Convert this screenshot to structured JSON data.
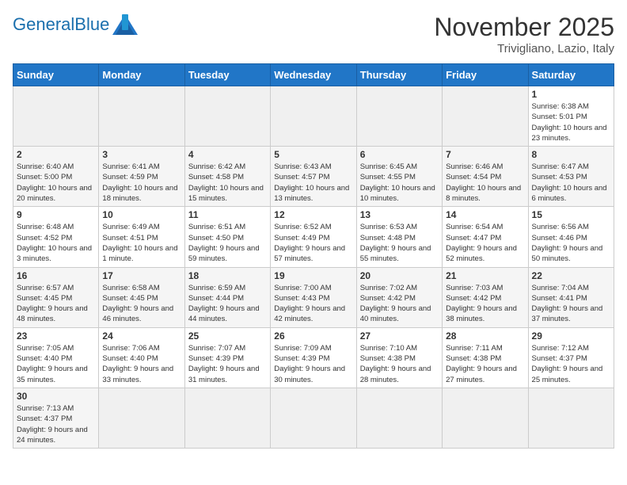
{
  "header": {
    "logo_general": "General",
    "logo_blue": "Blue",
    "month_title": "November 2025",
    "subtitle": "Trivigliano, Lazio, Italy"
  },
  "days_of_week": [
    "Sunday",
    "Monday",
    "Tuesday",
    "Wednesday",
    "Thursday",
    "Friday",
    "Saturday"
  ],
  "weeks": [
    [
      {
        "day": "",
        "info": ""
      },
      {
        "day": "",
        "info": ""
      },
      {
        "day": "",
        "info": ""
      },
      {
        "day": "",
        "info": ""
      },
      {
        "day": "",
        "info": ""
      },
      {
        "day": "",
        "info": ""
      },
      {
        "day": "1",
        "info": "Sunrise: 6:38 AM\nSunset: 5:01 PM\nDaylight: 10 hours and 23 minutes."
      }
    ],
    [
      {
        "day": "2",
        "info": "Sunrise: 6:40 AM\nSunset: 5:00 PM\nDaylight: 10 hours and 20 minutes."
      },
      {
        "day": "3",
        "info": "Sunrise: 6:41 AM\nSunset: 4:59 PM\nDaylight: 10 hours and 18 minutes."
      },
      {
        "day": "4",
        "info": "Sunrise: 6:42 AM\nSunset: 4:58 PM\nDaylight: 10 hours and 15 minutes."
      },
      {
        "day": "5",
        "info": "Sunrise: 6:43 AM\nSunset: 4:57 PM\nDaylight: 10 hours and 13 minutes."
      },
      {
        "day": "6",
        "info": "Sunrise: 6:45 AM\nSunset: 4:55 PM\nDaylight: 10 hours and 10 minutes."
      },
      {
        "day": "7",
        "info": "Sunrise: 6:46 AM\nSunset: 4:54 PM\nDaylight: 10 hours and 8 minutes."
      },
      {
        "day": "8",
        "info": "Sunrise: 6:47 AM\nSunset: 4:53 PM\nDaylight: 10 hours and 6 minutes."
      }
    ],
    [
      {
        "day": "9",
        "info": "Sunrise: 6:48 AM\nSunset: 4:52 PM\nDaylight: 10 hours and 3 minutes."
      },
      {
        "day": "10",
        "info": "Sunrise: 6:49 AM\nSunset: 4:51 PM\nDaylight: 10 hours and 1 minute."
      },
      {
        "day": "11",
        "info": "Sunrise: 6:51 AM\nSunset: 4:50 PM\nDaylight: 9 hours and 59 minutes."
      },
      {
        "day": "12",
        "info": "Sunrise: 6:52 AM\nSunset: 4:49 PM\nDaylight: 9 hours and 57 minutes."
      },
      {
        "day": "13",
        "info": "Sunrise: 6:53 AM\nSunset: 4:48 PM\nDaylight: 9 hours and 55 minutes."
      },
      {
        "day": "14",
        "info": "Sunrise: 6:54 AM\nSunset: 4:47 PM\nDaylight: 9 hours and 52 minutes."
      },
      {
        "day": "15",
        "info": "Sunrise: 6:56 AM\nSunset: 4:46 PM\nDaylight: 9 hours and 50 minutes."
      }
    ],
    [
      {
        "day": "16",
        "info": "Sunrise: 6:57 AM\nSunset: 4:45 PM\nDaylight: 9 hours and 48 minutes."
      },
      {
        "day": "17",
        "info": "Sunrise: 6:58 AM\nSunset: 4:45 PM\nDaylight: 9 hours and 46 minutes."
      },
      {
        "day": "18",
        "info": "Sunrise: 6:59 AM\nSunset: 4:44 PM\nDaylight: 9 hours and 44 minutes."
      },
      {
        "day": "19",
        "info": "Sunrise: 7:00 AM\nSunset: 4:43 PM\nDaylight: 9 hours and 42 minutes."
      },
      {
        "day": "20",
        "info": "Sunrise: 7:02 AM\nSunset: 4:42 PM\nDaylight: 9 hours and 40 minutes."
      },
      {
        "day": "21",
        "info": "Sunrise: 7:03 AM\nSunset: 4:42 PM\nDaylight: 9 hours and 38 minutes."
      },
      {
        "day": "22",
        "info": "Sunrise: 7:04 AM\nSunset: 4:41 PM\nDaylight: 9 hours and 37 minutes."
      }
    ],
    [
      {
        "day": "23",
        "info": "Sunrise: 7:05 AM\nSunset: 4:40 PM\nDaylight: 9 hours and 35 minutes."
      },
      {
        "day": "24",
        "info": "Sunrise: 7:06 AM\nSunset: 4:40 PM\nDaylight: 9 hours and 33 minutes."
      },
      {
        "day": "25",
        "info": "Sunrise: 7:07 AM\nSunset: 4:39 PM\nDaylight: 9 hours and 31 minutes."
      },
      {
        "day": "26",
        "info": "Sunrise: 7:09 AM\nSunset: 4:39 PM\nDaylight: 9 hours and 30 minutes."
      },
      {
        "day": "27",
        "info": "Sunrise: 7:10 AM\nSunset: 4:38 PM\nDaylight: 9 hours and 28 minutes."
      },
      {
        "day": "28",
        "info": "Sunrise: 7:11 AM\nSunset: 4:38 PM\nDaylight: 9 hours and 27 minutes."
      },
      {
        "day": "29",
        "info": "Sunrise: 7:12 AM\nSunset: 4:37 PM\nDaylight: 9 hours and 25 minutes."
      }
    ],
    [
      {
        "day": "30",
        "info": "Sunrise: 7:13 AM\nSunset: 4:37 PM\nDaylight: 9 hours and 24 minutes."
      },
      {
        "day": "",
        "info": ""
      },
      {
        "day": "",
        "info": ""
      },
      {
        "day": "",
        "info": ""
      },
      {
        "day": "",
        "info": ""
      },
      {
        "day": "",
        "info": ""
      },
      {
        "day": "",
        "info": ""
      }
    ]
  ]
}
